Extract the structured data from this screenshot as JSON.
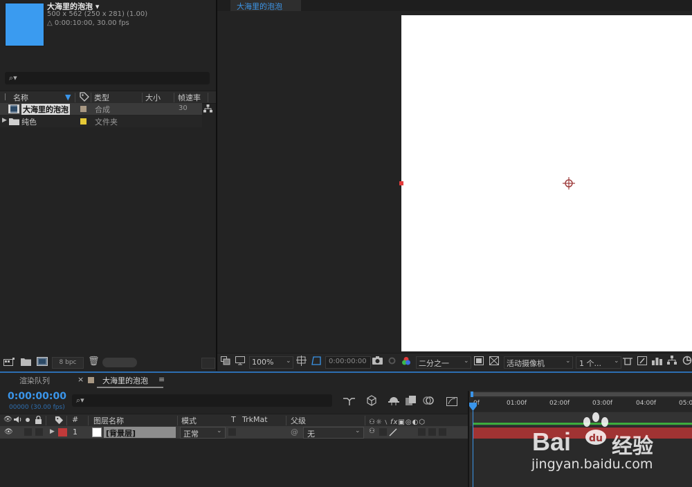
{
  "project": {
    "comp_name": "大海里的泡泡",
    "comp_dims": "500 x 562  (250 x 281) (1.00)",
    "comp_duration": "△ 0:00:10:00, 30.00 fps",
    "search_placeholder": "",
    "columns": {
      "name": "名称",
      "type": "类型",
      "size": "大小",
      "fps": "帧速率"
    },
    "items": [
      {
        "name": "大海里的泡泡",
        "type": "合成",
        "fps": "30",
        "label_color": "#a89883"
      },
      {
        "name": "纯色",
        "type": "文件夹",
        "fps": "",
        "label_color": "#e5c936"
      }
    ],
    "footer": {
      "bpc": "8 bpc"
    }
  },
  "viewer": {
    "tab_label": "大海里的泡泡",
    "zoom": "100%",
    "timecode": "0:00:00:00",
    "resolution": "二分之一",
    "camera": "活动摄像机",
    "views": "1 个..."
  },
  "timeline": {
    "tab_render_queue": "渲染队列",
    "tab_comp": "大海里的泡泡",
    "timecode": "0:00:00:00",
    "frames": "00000 (30.00 fps)",
    "columns": {
      "num": "#",
      "layer_name": "图层名称",
      "mode": "模式",
      "t": "T",
      "trkmat": "TrkMat",
      "parent": "父级"
    },
    "layer": {
      "num": "1",
      "name": "[背景层]",
      "mode": "正常",
      "parent": "无"
    },
    "ruler": [
      "0f",
      "01:00f",
      "02:00f",
      "03:00f",
      "04:00f",
      "05:0"
    ]
  },
  "watermark": {
    "brand": "Bai",
    "brand_cn": "经验",
    "url": "jingyan.baidu.com"
  },
  "colors": {
    "accent": "#3a95ea",
    "thumb": "#3a9bf0",
    "layer_bar": "#a03333",
    "work_area": "#3dac3d"
  }
}
